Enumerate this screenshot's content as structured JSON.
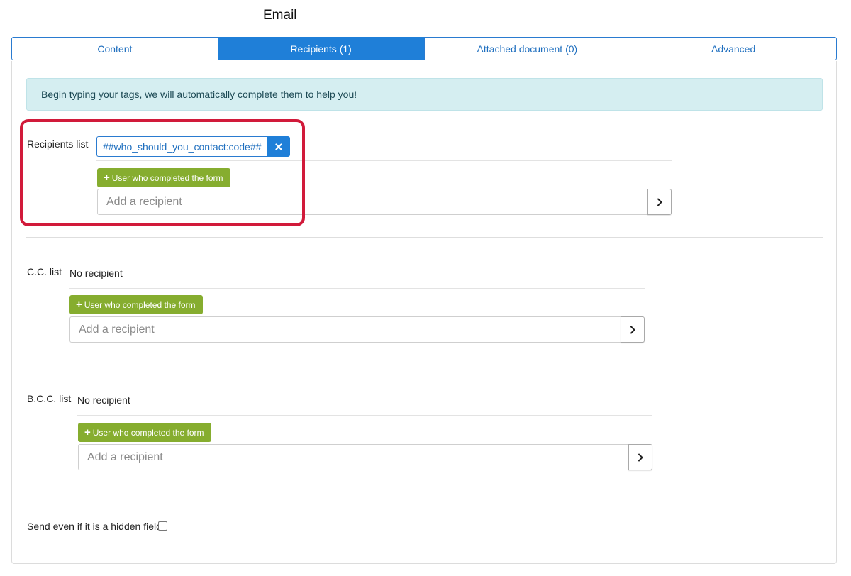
{
  "page": {
    "title": "Email"
  },
  "tabs": [
    {
      "label": "Content",
      "active": false
    },
    {
      "label": "Recipients (1)",
      "active": true
    },
    {
      "label": "Attached document (0)",
      "active": false
    },
    {
      "label": "Advanced",
      "active": false
    }
  ],
  "info": {
    "text": "Begin typing your tags, we will automatically complete them to help you!"
  },
  "recipients": {
    "label": "Recipients list",
    "tag": "##who_should_you_contact:code##",
    "remove_icon": "close-icon",
    "add_user_label": "User who completed the form",
    "input_placeholder": "Add a recipient",
    "go_icon": "chevron-right-icon"
  },
  "cc": {
    "label": "C.C. list",
    "value": "No recipient",
    "add_user_label": "User who completed the form",
    "input_placeholder": "Add a recipient"
  },
  "bcc": {
    "label": "B.C.C. list",
    "value": "No recipient",
    "add_user_label": "User who completed the form",
    "input_placeholder": "Add a recipient"
  },
  "hidden_field": {
    "label": "Send even if it is a hidden field",
    "checked": false
  },
  "colors": {
    "primary": "#1f7fd8",
    "success": "#86ad2f",
    "info_bg": "#d5eef1",
    "highlight": "#d11a3a"
  }
}
